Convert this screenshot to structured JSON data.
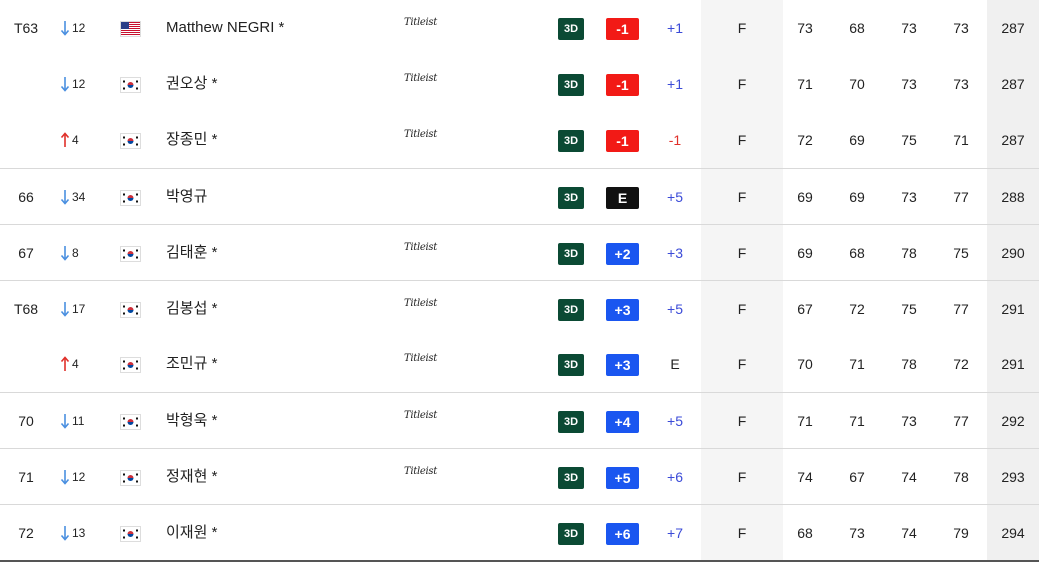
{
  "colors": {
    "over_par": "#1a56f0",
    "under_par": "#f21a16",
    "even": "#111111",
    "badge_3d": "#0b4a34",
    "move_down": "#4a8fe0",
    "move_up": "#e0302a",
    "today_over": "#3b4bd8",
    "today_under": "#e0302a",
    "today_even": "#222222"
  },
  "badge_3d_label": "3D",
  "rows": [
    {
      "pos": "T63",
      "move_dir": "down",
      "move": "12",
      "flag": "us-flag-icon",
      "name": "Matthew NEGRI *",
      "sponsor": "Titleist",
      "score": "-1",
      "score_kind": "under",
      "today": "+1",
      "today_kind": "over",
      "thru": "F",
      "r1": "73",
      "r2": "68",
      "r3": "73",
      "r4": "73",
      "total": "287",
      "sep": false
    },
    {
      "pos": "",
      "move_dir": "down",
      "move": "12",
      "flag": "kr-flag-icon",
      "name": "권오상 *",
      "sponsor": "Titleist",
      "score": "-1",
      "score_kind": "under",
      "today": "+1",
      "today_kind": "over",
      "thru": "F",
      "r1": "71",
      "r2": "70",
      "r3": "73",
      "r4": "73",
      "total": "287",
      "sep": false
    },
    {
      "pos": "",
      "move_dir": "up",
      "move": "4",
      "flag": "kr-flag-icon",
      "name": "장종민 *",
      "sponsor": "Titleist",
      "score": "-1",
      "score_kind": "under",
      "today": "-1",
      "today_kind": "under",
      "thru": "F",
      "r1": "72",
      "r2": "69",
      "r3": "75",
      "r4": "71",
      "total": "287",
      "sep": false
    },
    {
      "pos": "66",
      "move_dir": "down",
      "move": "34",
      "flag": "kr-flag-icon",
      "name": "박영규",
      "sponsor": "",
      "score": "E",
      "score_kind": "even",
      "today": "+5",
      "today_kind": "over",
      "thru": "F",
      "r1": "69",
      "r2": "69",
      "r3": "73",
      "r4": "77",
      "total": "288",
      "sep": true
    },
    {
      "pos": "67",
      "move_dir": "down",
      "move": "8",
      "flag": "kr-flag-icon",
      "name": "김태훈 *",
      "sponsor": "Titleist",
      "score": "+2",
      "score_kind": "over",
      "today": "+3",
      "today_kind": "over",
      "thru": "F",
      "r1": "69",
      "r2": "68",
      "r3": "78",
      "r4": "75",
      "total": "290",
      "sep": true
    },
    {
      "pos": "T68",
      "move_dir": "down",
      "move": "17",
      "flag": "kr-flag-icon",
      "name": "김봉섭 *",
      "sponsor": "Titleist",
      "score": "+3",
      "score_kind": "over",
      "today": "+5",
      "today_kind": "over",
      "thru": "F",
      "r1": "67",
      "r2": "72",
      "r3": "75",
      "r4": "77",
      "total": "291",
      "sep": true
    },
    {
      "pos": "",
      "move_dir": "up",
      "move": "4",
      "flag": "kr-flag-icon",
      "name": "조민규 *",
      "sponsor": "Titleist",
      "score": "+3",
      "score_kind": "over",
      "today": "E",
      "today_kind": "even",
      "thru": "F",
      "r1": "70",
      "r2": "71",
      "r3": "78",
      "r4": "72",
      "total": "291",
      "sep": false
    },
    {
      "pos": "70",
      "move_dir": "down",
      "move": "11",
      "flag": "kr-flag-icon",
      "name": "박형욱 *",
      "sponsor": "Titleist",
      "score": "+4",
      "score_kind": "over",
      "today": "+5",
      "today_kind": "over",
      "thru": "F",
      "r1": "71",
      "r2": "71",
      "r3": "73",
      "r4": "77",
      "total": "292",
      "sep": true
    },
    {
      "pos": "71",
      "move_dir": "down",
      "move": "12",
      "flag": "kr-flag-icon",
      "name": "정재현 *",
      "sponsor": "Titleist",
      "score": "+5",
      "score_kind": "over",
      "today": "+6",
      "today_kind": "over",
      "thru": "F",
      "r1": "74",
      "r2": "67",
      "r3": "74",
      "r4": "78",
      "total": "293",
      "sep": true
    },
    {
      "pos": "72",
      "move_dir": "down",
      "move": "13",
      "flag": "kr-flag-icon",
      "name": "이재원 *",
      "sponsor": "",
      "score": "+6",
      "score_kind": "over",
      "today": "+7",
      "today_kind": "over",
      "thru": "F",
      "r1": "68",
      "r2": "73",
      "r3": "74",
      "r4": "79",
      "total": "294",
      "sep": true
    }
  ]
}
